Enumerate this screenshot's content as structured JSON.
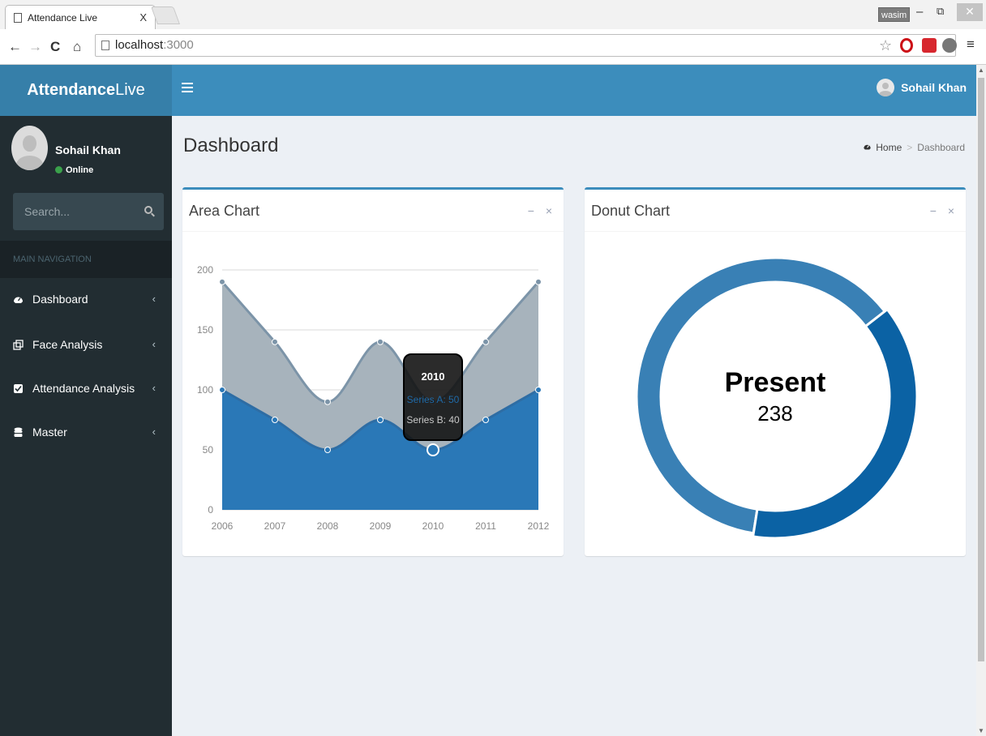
{
  "browser": {
    "tab_title": "Attendance Live",
    "tab_close": "X",
    "profile_name": "wasim",
    "url_host": "localhost",
    "url_port": ":3000"
  },
  "app": {
    "logo_bold": "Attendance",
    "logo_light": "Live",
    "topbar_user": "Sohail Khan",
    "accent_color": "#3c8dbc"
  },
  "sidebar": {
    "user_name": "Sohail Khan",
    "user_status": "Online",
    "search_placeholder": "Search...",
    "nav_header": "MAIN NAVIGATION",
    "items": [
      {
        "label": "Dashboard",
        "icon": "dashboard-icon"
      },
      {
        "label": "Face Analysis",
        "icon": "clone-icon"
      },
      {
        "label": "Attendance Analysis",
        "icon": "check-square-icon"
      },
      {
        "label": "Master",
        "icon": "database-icon"
      }
    ]
  },
  "page": {
    "title": "Dashboard",
    "breadcrumb_home": "Home",
    "breadcrumb_sep": ">",
    "breadcrumb_current": "Dashboard"
  },
  "area_box": {
    "title": "Area Chart",
    "minimize": "−",
    "close": "×"
  },
  "donut_box": {
    "title": "Donut Chart",
    "minimize": "−",
    "close": "×",
    "center_label": "Present",
    "center_value": "238"
  },
  "chart_data": [
    {
      "type": "area",
      "x": [
        "2006",
        "2007",
        "2008",
        "2009",
        "2010",
        "2011",
        "2012"
      ],
      "series": [
        {
          "values": [
            100,
            75,
            50,
            75,
            50,
            75,
            100
          ],
          "color": "#2a78b7"
        },
        {
          "values": [
            90,
            65,
            40,
            65,
            40,
            65,
            90
          ],
          "color": "#a7b3bc"
        }
      ],
      "stacked": true,
      "ylim": [
        0,
        200
      ],
      "yticks": [
        0,
        50,
        100,
        150,
        200
      ],
      "grid": true,
      "tooltip": {
        "title": "2010",
        "lines": [
          {
            "label": "Series A: 50",
            "color": "#1f6aa8"
          },
          {
            "label": "Series B: 40",
            "color": "#c8c8c8"
          }
        ]
      }
    },
    {
      "type": "pie",
      "donut": true,
      "segments": [
        {
          "value": 62,
          "color": "#3980b5"
        },
        {
          "value": 38,
          "color": "#0b62a4"
        }
      ],
      "highlighted_label": "Present",
      "highlighted_value": 238
    }
  ]
}
